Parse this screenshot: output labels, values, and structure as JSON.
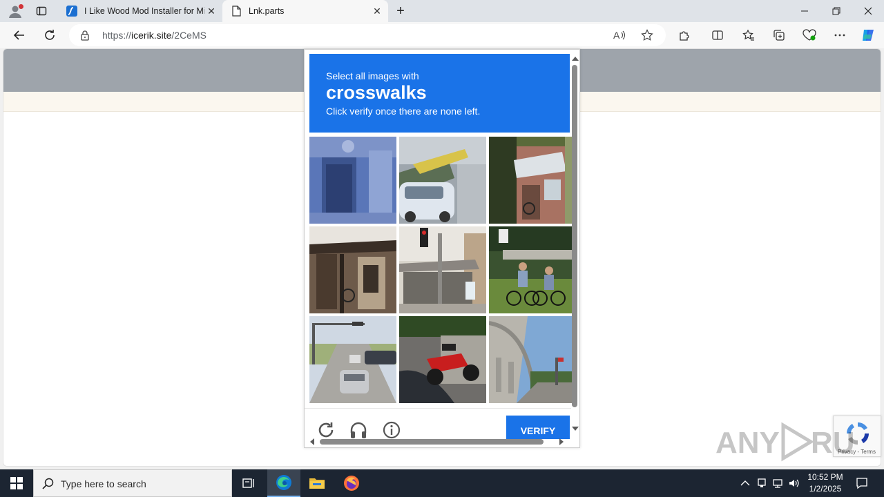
{
  "browser": {
    "tabs": [
      {
        "title": "I Like Wood Mod Installer for Mir",
        "active": false
      },
      {
        "title": "Lnk.parts",
        "active": true
      }
    ],
    "address": {
      "scheme": "https://",
      "host": "icerik.site",
      "path": "/2CeMS"
    }
  },
  "captcha": {
    "prompt_pre": "Select all images with",
    "keyword": "crosswalks",
    "prompt_post": "Click verify once there are none left.",
    "verify_label": "VERIFY",
    "header_color": "#1a73e8",
    "tiles": [
      "building-doorway",
      "parked-cars-street",
      "storefront-awning",
      "old-shop-front",
      "traffic-light-bus-stop",
      "cyclists-park",
      "highway-traffic-light",
      "red-motorcycle",
      "overpass-road"
    ]
  },
  "recaptcha_badge": {
    "links": "Privacy - Terms"
  },
  "watermark": "ANY RUN",
  "taskbar": {
    "search_placeholder": "Type here to search",
    "time": "10:52 PM",
    "date": "1/2/2025"
  }
}
